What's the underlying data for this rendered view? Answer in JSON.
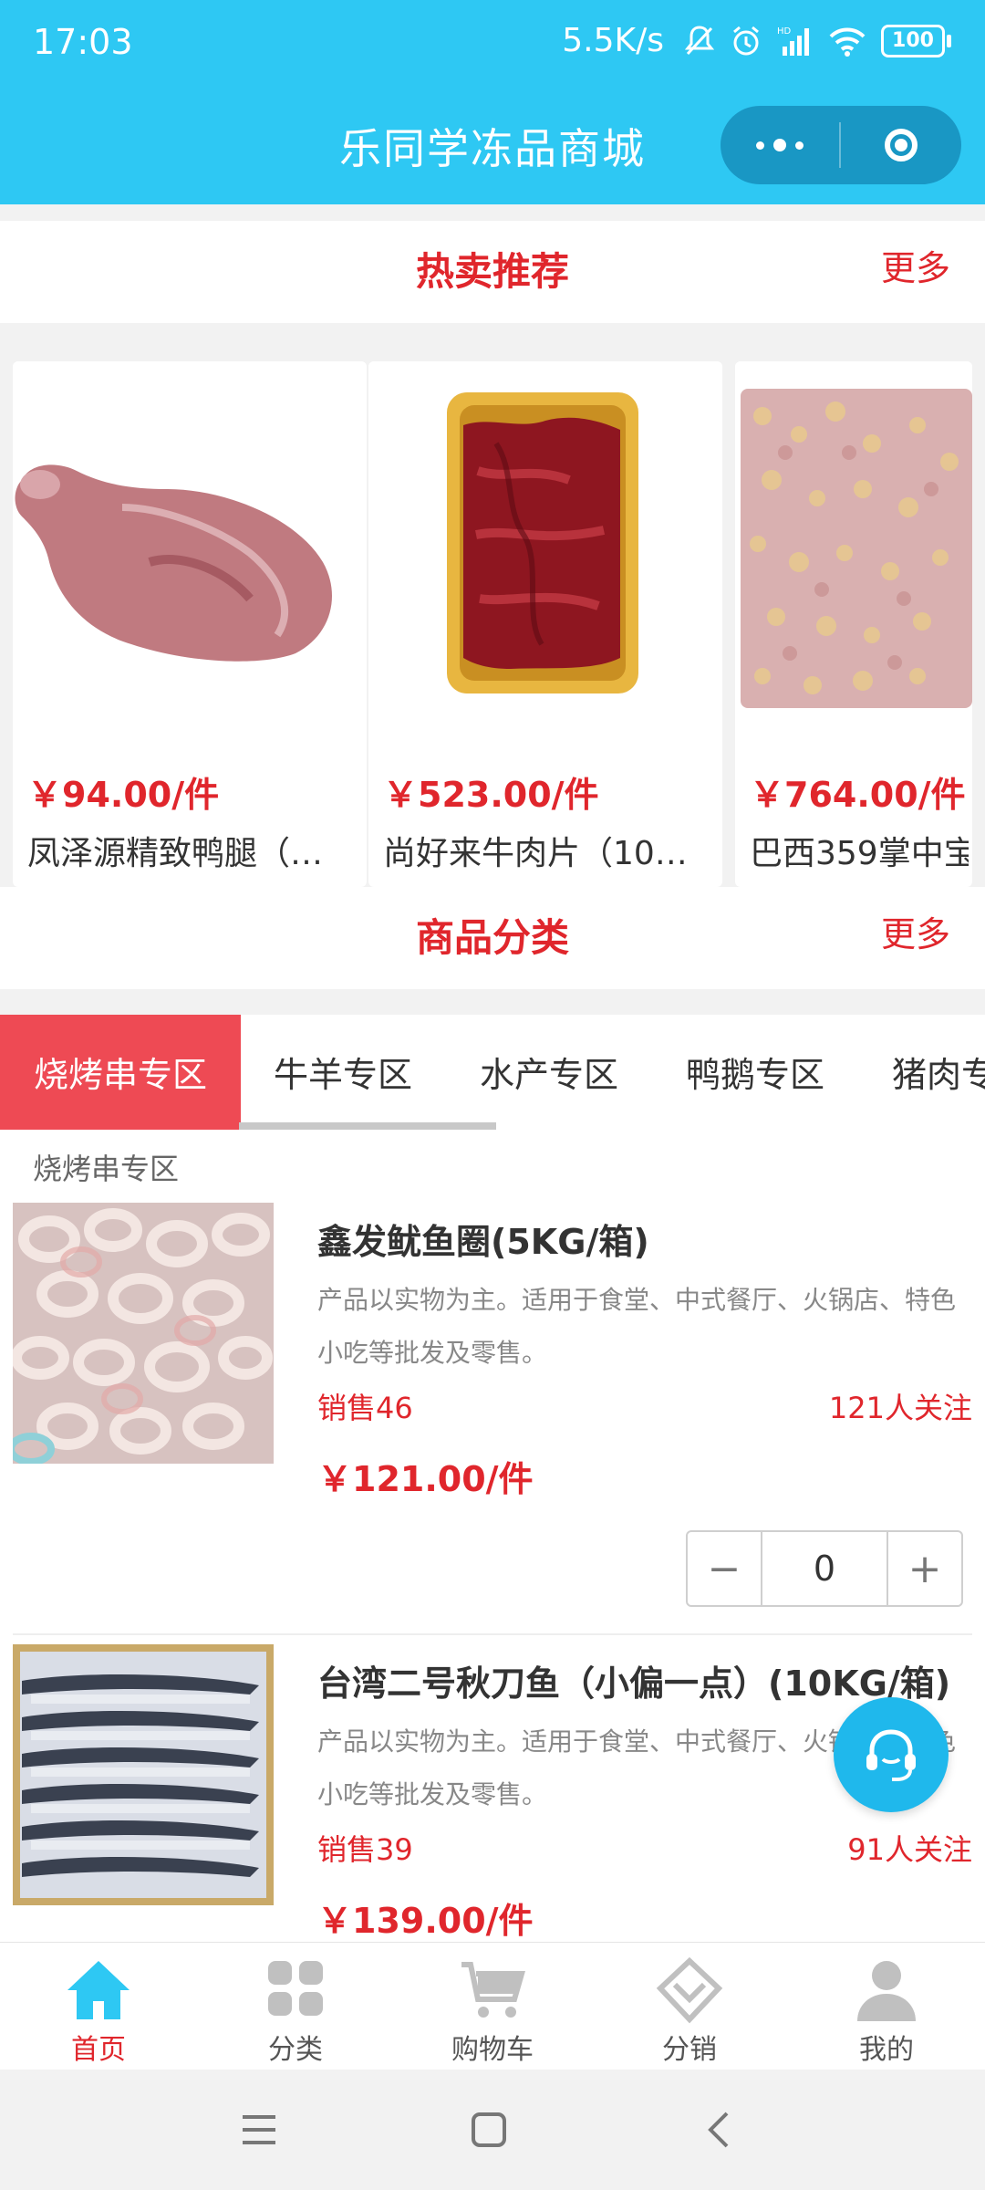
{
  "status": {
    "time": "17:03",
    "speed": "5.5K/s",
    "hd": "HD",
    "battery": "100"
  },
  "header": {
    "title": "乐同学冻品商城"
  },
  "hot": {
    "title": "热卖推荐",
    "more": "更多",
    "products": [
      {
        "price": "￥94.00/件",
        "name": "凤泽源精致鸭腿（…"
      },
      {
        "price": "￥523.00/件",
        "name": "尚好来牛肉片（10…"
      },
      {
        "price": "￥764.00/件",
        "name": "巴西359掌中宝"
      }
    ]
  },
  "categories": {
    "title": "商品分类",
    "more": "更多",
    "tabs": [
      "烧烤串专区",
      "牛羊专区",
      "水产专区",
      "鸭鹅专区",
      "猪肉专"
    ],
    "active_tab": "烧烤串专区",
    "section_label": "烧烤串专区",
    "items": [
      {
        "title": "鑫发鱿鱼圈(5KG/箱)",
        "desc": "产品以实物为主。适用于食堂、中式餐厅、火锅店、特色小吃等批发及零售。",
        "sales": "销售46",
        "follow": "121人关注",
        "price": "￥121.00/件",
        "qty": "0",
        "minus": "−",
        "plus": "+"
      },
      {
        "title": "台湾二号秋刀鱼（小偏一点）(10KG/箱)",
        "desc": "产品以实物为主。适用于食堂、中式餐厅、火锅店、特色小吃等批发及零售。",
        "sales": "销售39",
        "follow": "91人关注",
        "price": "￥139.00/件"
      }
    ]
  },
  "tabbar": {
    "items": [
      {
        "label": "首页",
        "icon": "home-icon"
      },
      {
        "label": "分类",
        "icon": "category-icon"
      },
      {
        "label": "购物车",
        "icon": "cart-icon"
      },
      {
        "label": "分销",
        "icon": "distribution-icon"
      },
      {
        "label": "我的",
        "icon": "user-icon"
      }
    ],
    "active": "首页"
  },
  "colors": {
    "header": "#2ec8f3",
    "accent_red": "#e0262c",
    "tab_active": "#ee4a54",
    "tabbar_active_icon": "#2ec8f3",
    "service": "#1fb8ec"
  }
}
